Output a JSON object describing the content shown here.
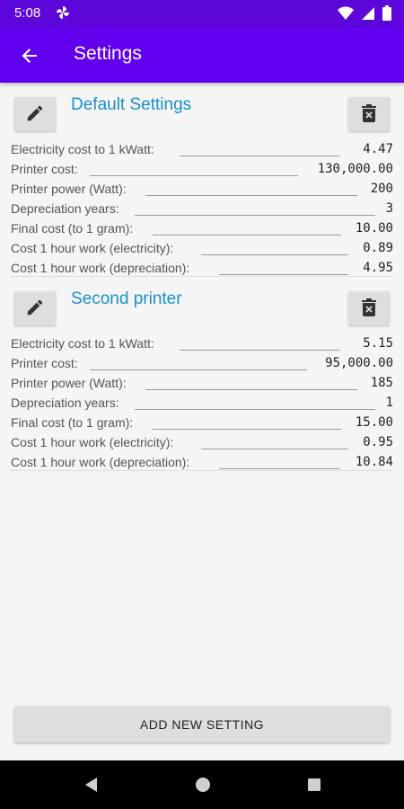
{
  "status_bar": {
    "time": "5:08"
  },
  "app_bar": {
    "title": "Settings"
  },
  "profiles": [
    {
      "title": "Default Settings",
      "rows": [
        {
          "label": "Electricity cost to 1 kWatt:",
          "value": "4.47"
        },
        {
          "label": "Printer cost:",
          "value": "130,000.00"
        },
        {
          "label": "Printer power (Watt):",
          "value": "200"
        },
        {
          "label": "Depreciation years:",
          "value": "3"
        },
        {
          "label": "Final cost (to 1 gram):",
          "value": "10.00"
        },
        {
          "label": "Cost 1 hour work (electricity):",
          "value": "0.89"
        },
        {
          "label": "Cost 1 hour work (depreciation):",
          "value": "4.95"
        }
      ]
    },
    {
      "title": "Second printer",
      "rows": [
        {
          "label": "Electricity cost to 1 kWatt:",
          "value": "5.15"
        },
        {
          "label": "Printer cost:",
          "value": "95,000.00"
        },
        {
          "label": "Printer power (Watt):",
          "value": "185"
        },
        {
          "label": "Depreciation years:",
          "value": "1"
        },
        {
          "label": "Final cost (to 1 gram):",
          "value": "15.00"
        },
        {
          "label": "Cost 1 hour work (electricity):",
          "value": "0.95"
        },
        {
          "label": "Cost 1 hour work (depreciation):",
          "value": "10.84"
        }
      ]
    }
  ],
  "add_button_label": "ADD NEW SETTING",
  "colors": {
    "primary": "#6200ee",
    "status_bar": "#5c06da",
    "title": "#1a8fc8"
  }
}
